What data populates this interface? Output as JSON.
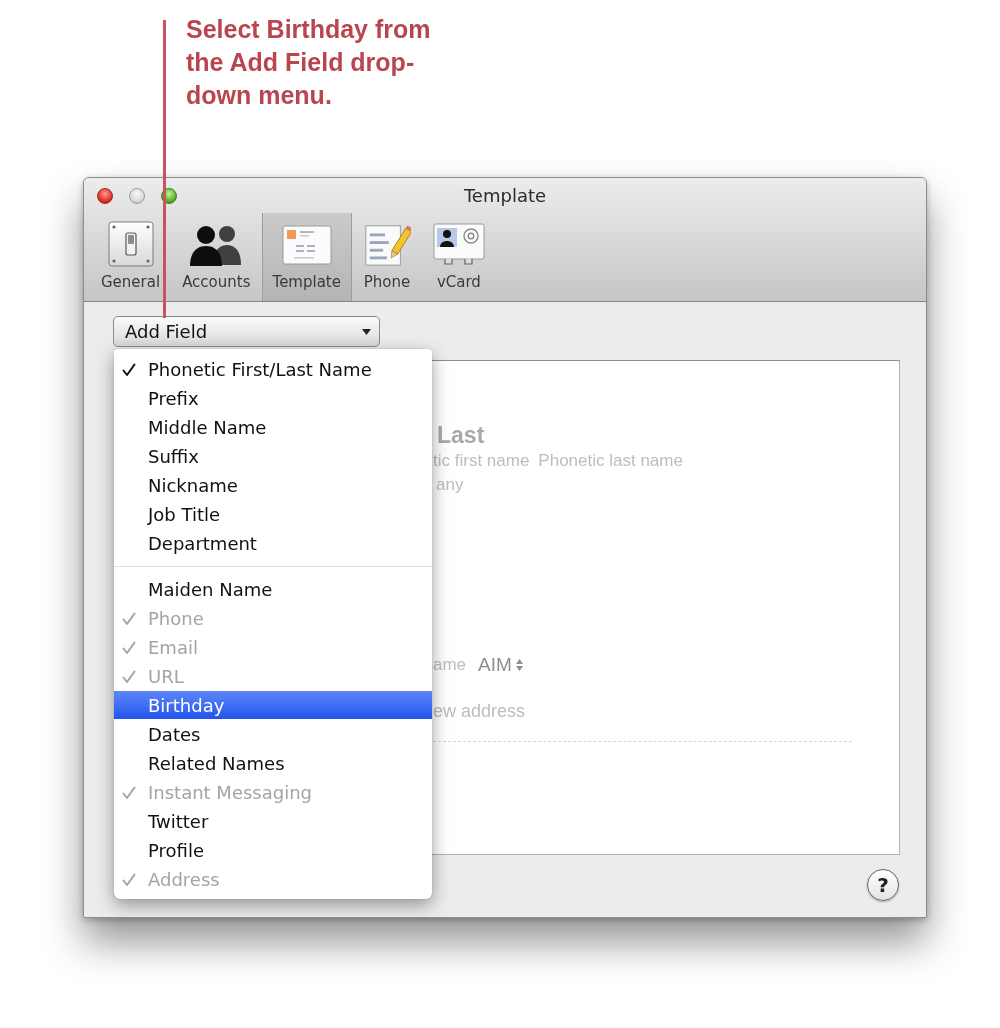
{
  "callout": {
    "text": "Select Birthday from the Add Field drop-down menu."
  },
  "window": {
    "title": "Template"
  },
  "toolbar": [
    {
      "label": "General",
      "selected": false
    },
    {
      "label": "Accounts",
      "selected": false
    },
    {
      "label": "Template",
      "selected": true
    },
    {
      "label": "Phone",
      "selected": false
    },
    {
      "label": "vCard",
      "selected": false
    }
  ],
  "add_field": {
    "label": "Add Field"
  },
  "menu": {
    "sections": [
      {
        "items": [
          {
            "label": "Phonetic First/Last Name",
            "checked": true,
            "disabled": false,
            "selected": false
          },
          {
            "label": "Prefix",
            "checked": false,
            "disabled": false,
            "selected": false
          },
          {
            "label": "Middle Name",
            "checked": false,
            "disabled": false,
            "selected": false
          },
          {
            "label": "Suffix",
            "checked": false,
            "disabled": false,
            "selected": false
          },
          {
            "label": "Nickname",
            "checked": false,
            "disabled": false,
            "selected": false
          },
          {
            "label": "Job Title",
            "checked": false,
            "disabled": false,
            "selected": false
          },
          {
            "label": "Department",
            "checked": false,
            "disabled": false,
            "selected": false
          }
        ]
      },
      {
        "items": [
          {
            "label": "Maiden Name",
            "checked": false,
            "disabled": false,
            "selected": false
          },
          {
            "label": "Phone",
            "checked": true,
            "disabled": true,
            "selected": false
          },
          {
            "label": "Email",
            "checked": true,
            "disabled": true,
            "selected": false
          },
          {
            "label": "URL",
            "checked": true,
            "disabled": true,
            "selected": false
          },
          {
            "label": "Birthday",
            "checked": false,
            "disabled": false,
            "selected": true
          },
          {
            "label": "Dates",
            "checked": false,
            "disabled": false,
            "selected": false
          },
          {
            "label": "Related Names",
            "checked": false,
            "disabled": false,
            "selected": false
          },
          {
            "label": "Instant Messaging",
            "checked": true,
            "disabled": true,
            "selected": false
          },
          {
            "label": "Twitter",
            "checked": false,
            "disabled": false,
            "selected": false
          },
          {
            "label": "Profile",
            "checked": false,
            "disabled": false,
            "selected": false
          },
          {
            "label": "Address",
            "checked": true,
            "disabled": true,
            "selected": false
          }
        ]
      }
    ]
  },
  "template_preview": {
    "name": "Last",
    "phonetic_first": "tic first name",
    "phonetic_last": "Phonetic last name",
    "company": "any",
    "im_label": "ame",
    "im_service": "AIM",
    "address": "ew address"
  },
  "help_button": {
    "label": "?"
  }
}
